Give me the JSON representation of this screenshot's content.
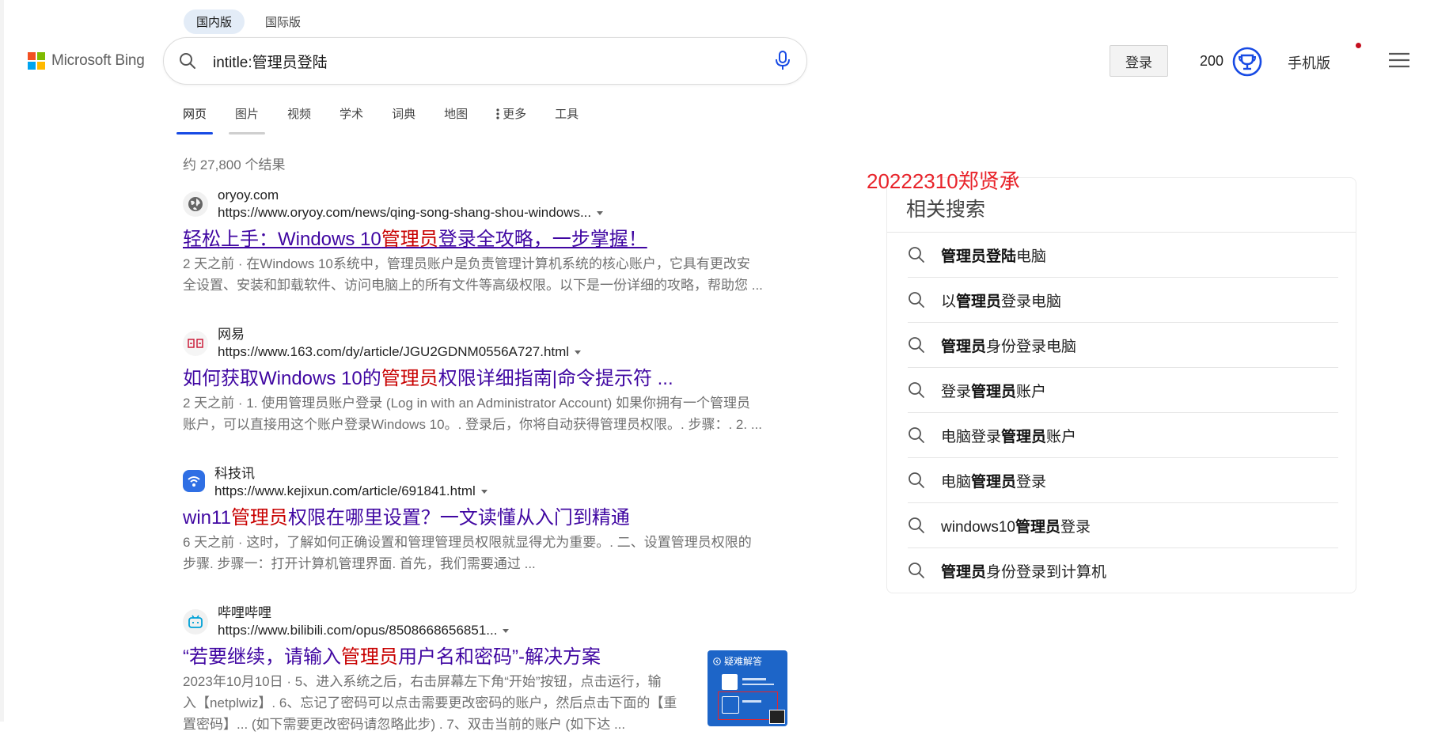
{
  "header": {
    "logo_text": "Microsoft Bing",
    "scope_tabs": [
      "国内版",
      "国际版"
    ],
    "search_query": "intitle:管理员登陆",
    "login_label": "登录",
    "points": "200",
    "mobile_label": "手机版"
  },
  "nav": {
    "items": [
      "网页",
      "图片",
      "视频",
      "学术",
      "词典",
      "地图",
      "更多",
      "工具"
    ]
  },
  "result_count": "约 27,800 个结果",
  "results": [
    {
      "site": "oryoy.com",
      "url": "https://www.oryoy.com/news/qing-song-shang-shou-windows...",
      "title_pre": "轻松上手：Windows 10",
      "title_hl": "管理员",
      "title_post": "登录全攻略，一步掌握！",
      "date": "2 天之前",
      "snippet_1": "在Windows 10系统中，管理员账户是负责管理计算机系统的核心账户，它具有更改安",
      "snippet_2": "全设置、安装和卸载软件、访问电脑上的所有文件等高级权限。以下是一份详细的攻略，帮助您 ..."
    },
    {
      "site": "网易",
      "url": "https://www.163.com/dy/article/JGU2GDNM0556A727.html",
      "title_pre": "如何获取Windows 10的",
      "title_hl": "管理员",
      "title_post": "权限详细指南|命令提示符 ...",
      "date": "2 天之前",
      "snippet_1": "1. 使用管理员账户登录 (Log in with an Administrator Account) 如果你拥有一个管理员",
      "snippet_2": "账户，可以直接用这个账户登录Windows 10。. 登录后，你将自动获得管理员权限。. 步骤：. 2. ..."
    },
    {
      "site": "科技讯",
      "url": "https://www.kejixun.com/article/691841.html",
      "title_pre": "win11",
      "title_hl": "管理员",
      "title_post": "权限在哪里设置？一文读懂从入门到精通",
      "date": "6 天之前",
      "snippet_1": "这时，了解如何正确设置和管理管理员权限就显得尤为重要。. 二、设置管理员权限的",
      "snippet_2": "步骤. 步骤一：打开计算机管理界面. 首先，我们需要通过 ..."
    },
    {
      "site": "哔哩哔哩",
      "url": "https://www.bilibili.com/opus/8508668656851...",
      "title_pre": "“若要继续，请输入",
      "title_hl": "管理员",
      "title_post": "用户名和密码”-解决方案",
      "date": "2023年10月10日",
      "snippet_1": "5、进入系统之后，右击屏幕左下角“开始”按钮，点击运行，输",
      "snippet_2": "入【netplwiz】. 6、忘记了密码可以点击需要更改密码的账户，然后点击下面的【重",
      "snippet_3": "置密码】... (如下需要更改密码请忽略此步) . 7、双击当前的账户 (如下达 ...",
      "thumb_title": "疑难解答"
    }
  ],
  "watermark": "20222310郑贤承",
  "related": {
    "title": "相关搜索",
    "items": [
      {
        "b1": "管理员登陆",
        "t1": "电脑",
        "b2": "",
        "t2": "",
        "pre": ""
      },
      {
        "pre": "以",
        "b1": "管理员",
        "t1": "登录电脑",
        "b2": "",
        "t2": ""
      },
      {
        "pre": "",
        "b1": "管理员",
        "t1": "身份登录电脑",
        "b2": "",
        "t2": ""
      },
      {
        "pre": "登录",
        "b1": "管理员",
        "t1": "账户",
        "b2": "",
        "t2": ""
      },
      {
        "pre": "电脑登录",
        "b1": "管理员",
        "t1": "账户",
        "b2": "",
        "t2": ""
      },
      {
        "pre": "电脑",
        "b1": "管理员",
        "t1": "登录",
        "b2": "",
        "t2": ""
      },
      {
        "pre": "windows10",
        "b1": "管理员",
        "t1": "登录",
        "b2": "",
        "t2": ""
      },
      {
        "pre": "",
        "b1": "管理员",
        "t1": "身份登录到计算机",
        "b2": "",
        "t2": ""
      }
    ]
  },
  "colors": {
    "accent": "#174ae4",
    "title_link": "#4007a2",
    "highlight": "#c80000",
    "watermark": "#e8232a"
  }
}
